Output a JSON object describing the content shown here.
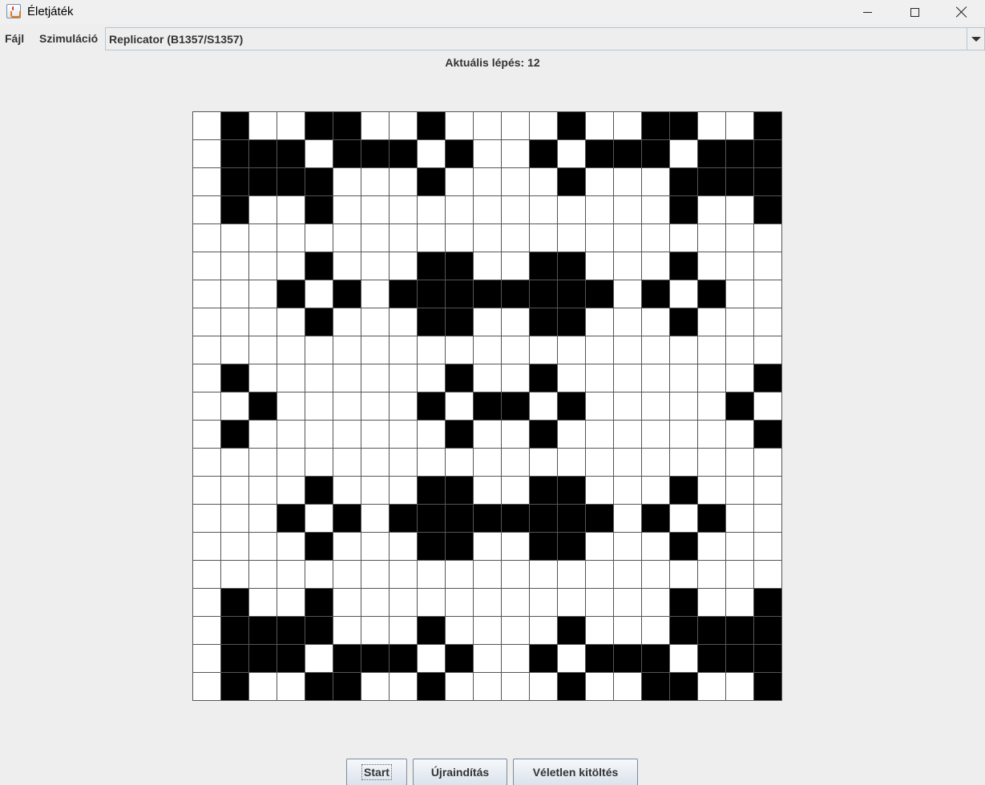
{
  "window": {
    "title": "Életjáték",
    "icon": "java-cup-icon",
    "controls": [
      "minimize-icon",
      "maximize-icon",
      "close-icon"
    ]
  },
  "menu": {
    "file": "Fájl",
    "simulation": "Szimuláció"
  },
  "rule_select": {
    "value": "Replicator (B1357/S1357)"
  },
  "status": {
    "step_label": "Aktuális lépés: 12"
  },
  "board": {
    "size": 21,
    "alive_color": "#000000",
    "dead_color": "#ffffff",
    "rows": [
      "010011001000010011001",
      "011101110100101110111",
      "011110001000010001111",
      "010010000000000001001",
      "000000000000000000000",
      "000010001100110001000",
      "000101011111111010100",
      "000010001100110001000",
      "000000000000000000000",
      "010000000100100000001",
      "001000001011010000010",
      "010000000100100000001",
      "000000000000000000000",
      "000010001100110001000",
      "000101011111111010100",
      "000010001100110001000",
      "000000000000000000000",
      "010010000000000001001",
      "011110001000010001111",
      "011101110100101110111",
      "010011001000010011001"
    ]
  },
  "buttons": {
    "start": "Start",
    "restart": "Újraindítás",
    "random_fill": "Véletlen kitöltés"
  }
}
